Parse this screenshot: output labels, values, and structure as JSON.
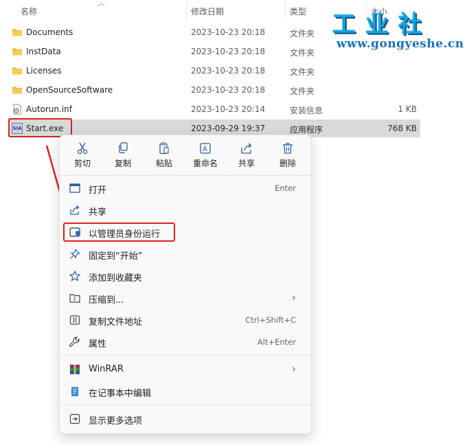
{
  "header": {
    "col_name": "名称",
    "col_date": "修改日期",
    "col_type": "类型",
    "col_size": "大小"
  },
  "files": [
    {
      "name": "Documents",
      "date": "2023-10-23 20:18",
      "type": "文件夹",
      "size": "",
      "icon": "folder-icon"
    },
    {
      "name": "InstData",
      "date": "2023-10-23 20:18",
      "type": "文件夹",
      "size": "",
      "icon": "folder-icon"
    },
    {
      "name": "Licenses",
      "date": "2023-10-23 20:18",
      "type": "文件夹",
      "size": "",
      "icon": "folder-icon"
    },
    {
      "name": "OpenSourceSoftware",
      "date": "2023-10-23 20:18",
      "type": "文件夹",
      "size": "",
      "icon": "folder-icon"
    },
    {
      "name": "Autorun.inf",
      "date": "2023-10-23 20:14",
      "type": "安装信息",
      "size": "1 KB",
      "icon": "inf-file-icon"
    },
    {
      "name": "Start.exe",
      "date": "2023-09-29 19:37",
      "type": "应用程序",
      "size": "768 KB",
      "icon": "exe-icon",
      "selected": true
    }
  ],
  "watermark": {
    "title": "工业社",
    "url": "www.gongyeshe.cn"
  },
  "context_menu": {
    "quick_actions": [
      {
        "label": "剪切",
        "icon": "cut-icon"
      },
      {
        "label": "复制",
        "icon": "copy-icon"
      },
      {
        "label": "粘贴",
        "icon": "paste-icon"
      },
      {
        "label": "重命名",
        "icon": "rename-icon"
      },
      {
        "label": "共享",
        "icon": "share-icon"
      },
      {
        "label": "删除",
        "icon": "delete-icon"
      }
    ],
    "items": [
      {
        "label": "打开",
        "shortcut": "Enter",
        "icon": "open-icon"
      },
      {
        "label": "共享",
        "shortcut": "",
        "icon": "share-icon"
      },
      {
        "label": "以管理员身份运行",
        "shortcut": "",
        "icon": "shield-icon",
        "highlighted": true
      },
      {
        "label": "固定到“开始”",
        "shortcut": "",
        "icon": "pin-icon"
      },
      {
        "label": "添加到收藏夹",
        "shortcut": "",
        "icon": "star-icon"
      },
      {
        "label": "压缩到...",
        "shortcut": "",
        "icon": "zip-folder-icon",
        "submenu": true
      },
      {
        "label": "复制文件地址",
        "shortcut": "Ctrl+Shift+C",
        "icon": "copy-path-icon"
      },
      {
        "label": "属性",
        "shortcut": "Alt+Enter",
        "icon": "wrench-icon"
      },
      {
        "label": "WinRAR",
        "shortcut": "",
        "icon": "winrar-icon",
        "submenu": true
      },
      {
        "label": "在记事本中编辑",
        "shortcut": "",
        "icon": "notepad-icon"
      },
      {
        "label": "显示更多选项",
        "shortcut": "",
        "icon": "more-options-icon"
      }
    ]
  },
  "colors": {
    "highlight_red": "#e02020",
    "accent_blue": "#1a6fb8",
    "folder_yellow": "#f4c542",
    "selected_row": "#d9d9d9"
  }
}
